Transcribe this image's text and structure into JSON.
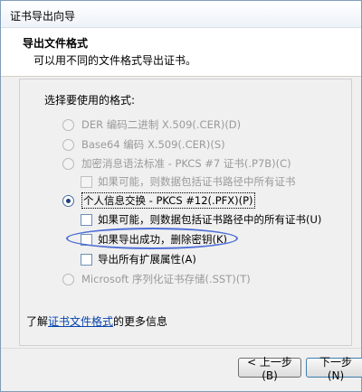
{
  "window": {
    "title": "证书导出向导"
  },
  "header": {
    "title": "导出文件格式",
    "subtitle": "可以用不同的文件格式导出证书。"
  },
  "body": {
    "section_label": "选择要使用的格式:",
    "options": {
      "der": "DER 编码二进制 X.509(.CER)(D)",
      "base64": "Base64 编码 X.509(.CER)(S)",
      "pkcs7": "加密消息语法标准 - PKCS #7 证书(.P7B)(C)",
      "pkcs7_include": "如果可能，则数据包括证书路径中所有证书",
      "pfx": "个人信息交换 - PKCS #12(.PFX)(P)",
      "pfx_include": "如果可能，则数据包括证书路径中的所有证书(U)",
      "pfx_delete": "如果导出成功，删除密钥(K)",
      "pfx_export_props": "导出所有扩展属性(A)",
      "sst": "Microsoft 序列化证书存储(.SST)(T)"
    },
    "more_info_prefix": "了解",
    "more_info_link": "证书文件格式",
    "more_info_suffix": "的更多信息"
  },
  "footer": {
    "back_label": "< 上一步(B)",
    "next_label": "下一步(N)"
  }
}
